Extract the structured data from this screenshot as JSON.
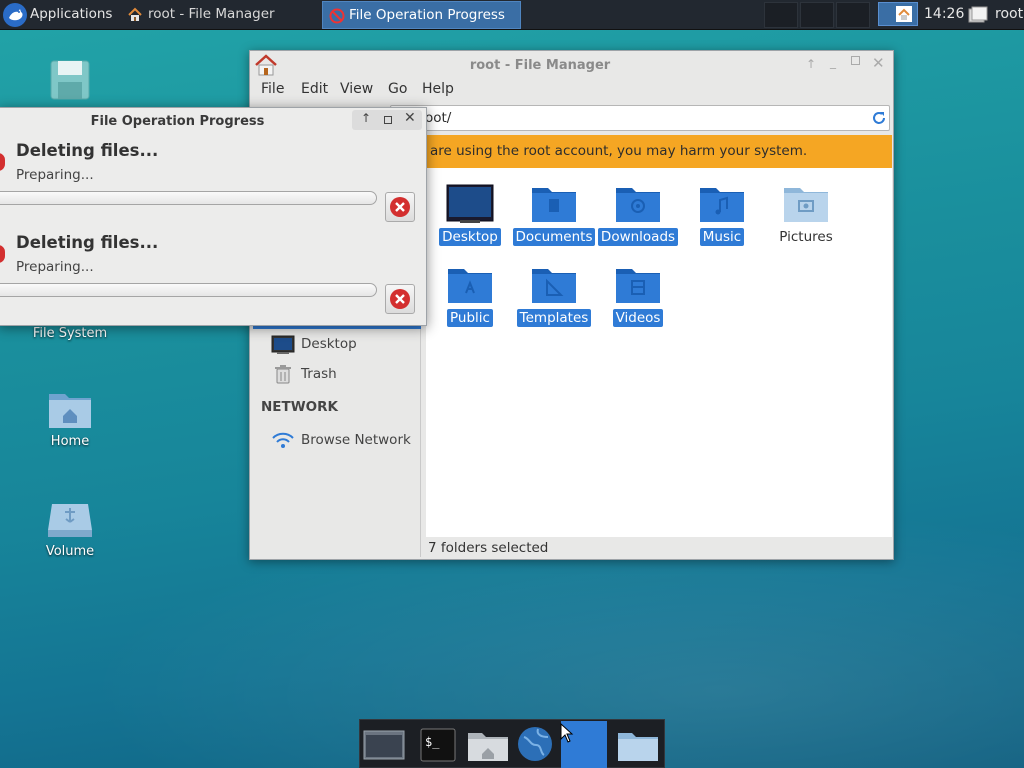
{
  "topbar": {
    "applications_label": "Applications",
    "task_file_manager": "root - File Manager",
    "task_progress": "File Operation Progress",
    "clock": "14:26",
    "user": "root"
  },
  "desktop": {
    "icons": [
      {
        "label": "File System"
      },
      {
        "label": "Home"
      },
      {
        "label": "Volume"
      }
    ]
  },
  "file_manager": {
    "title": "root - File Manager",
    "menu": [
      "File",
      "Edit",
      "View",
      "Go",
      "Help"
    ],
    "location": "/root/",
    "location_visible": "oot/",
    "warning": "are using the root account, you may harm your system.",
    "sidebar": {
      "places": [
        "Desktop",
        "Trash"
      ],
      "network_header": "NETWORK",
      "network_items": [
        "Browse Network"
      ]
    },
    "folders": [
      {
        "name": "Desktop",
        "selected": true
      },
      {
        "name": "Documents",
        "selected": true
      },
      {
        "name": "Downloads",
        "selected": true
      },
      {
        "name": "Music",
        "selected": true
      },
      {
        "name": "Pictures",
        "selected": false
      },
      {
        "name": "Public",
        "selected": true
      },
      {
        "name": "Templates",
        "selected": true
      },
      {
        "name": "Videos",
        "selected": true
      }
    ],
    "status": "7 folders selected"
  },
  "progress_dialog": {
    "title": "File Operation Progress",
    "operations": [
      {
        "heading": "Deleting files...",
        "status": "Preparing...",
        "progress": 0
      },
      {
        "heading": "Deleting files...",
        "status": "Preparing...",
        "progress": 0
      }
    ]
  },
  "colors": {
    "selection": "#2f7bd6",
    "warning_bar": "#f5a623",
    "topbar": "#222830",
    "active_task": "#3a6ea5"
  },
  "dock_items": [
    "workspace-icon",
    "terminal-icon",
    "home-folder-icon",
    "web-browser-icon",
    "active-window-icon",
    "files-icon"
  ]
}
